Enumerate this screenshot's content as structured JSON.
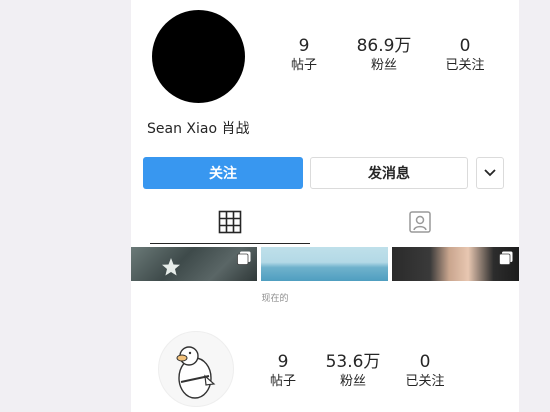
{
  "profile": {
    "username": "Sean Xiao 肖战",
    "stats": [
      {
        "value": "9",
        "label": "帖子"
      },
      {
        "value": "86.9万",
        "label": "粉丝"
      },
      {
        "value": "0",
        "label": "已关注"
      }
    ]
  },
  "actions": {
    "follow_label": "关注",
    "message_label": "发消息"
  },
  "tabs": [
    {
      "name": "grid",
      "icon": "grid-icon",
      "active": true
    },
    {
      "name": "tagged",
      "icon": "tagged-person-icon",
      "active": false
    }
  ],
  "caption": "现在的",
  "profile_2": {
    "stats": [
      {
        "value": "9",
        "label": "帖子"
      },
      {
        "value": "53.6万",
        "label": "粉丝"
      },
      {
        "value": "0",
        "label": "已关注"
      }
    ]
  },
  "colors": {
    "accent": "#3897f0",
    "border": "#dbdbdb",
    "text": "#262626",
    "muted": "#8e8e8e"
  }
}
